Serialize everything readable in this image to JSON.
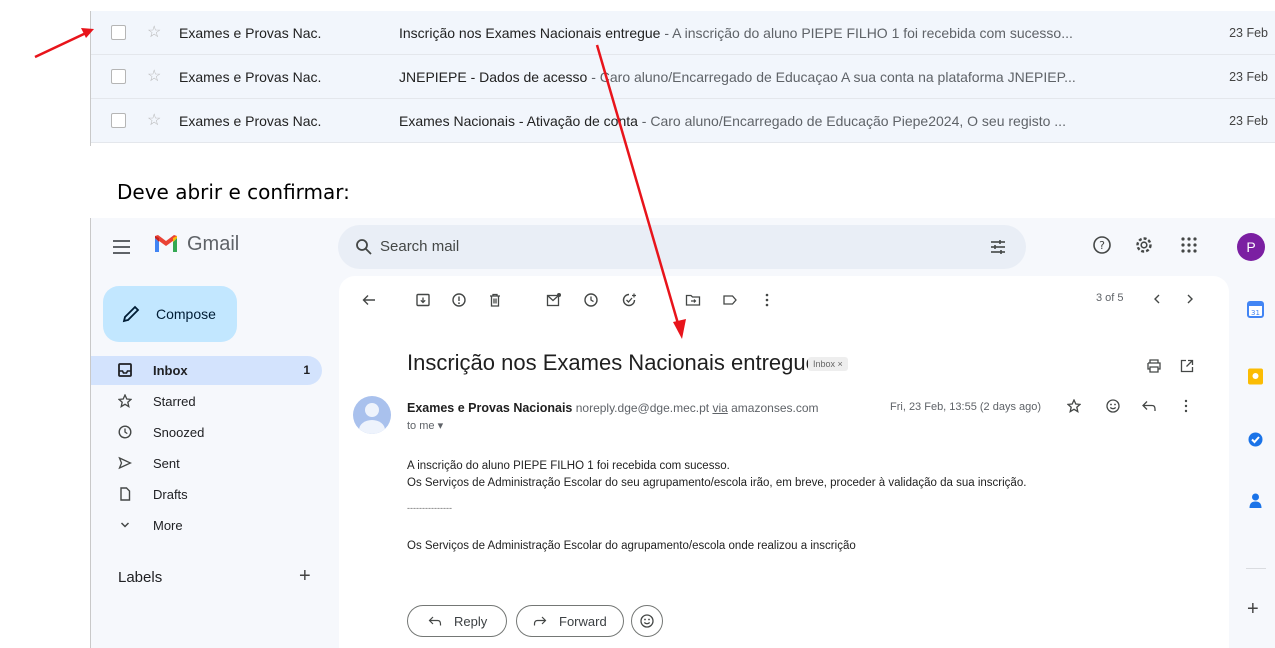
{
  "inbox_list": {
    "rows": [
      {
        "sender": "Exames e Provas Nac.",
        "subject": "Inscrição nos Exames Nacionais entregue",
        "snippet": " - A inscrição do aluno PIEPE FILHO 1 foi recebida com sucesso...",
        "date": "23 Feb"
      },
      {
        "sender": "Exames e Provas Nac.",
        "subject": "JNEPIEPE - Dados de acesso",
        "snippet": " - Caro aluno/Encarregado de Educaçao A sua conta na plataforma JNEPIEP...",
        "date": "23 Feb"
      },
      {
        "sender": "Exames e Provas Nac.",
        "subject": "Exames Nacionais - Ativação de conta",
        "snippet": " - Caro aluno/Encarregado de Educação Piepe2024, O seu registo ...",
        "date": "23 Feb"
      }
    ]
  },
  "instruction": "Deve abrir e confirmar:",
  "header": {
    "app_name": "Gmail",
    "search_placeholder": "Search mail",
    "avatar_letter": "P"
  },
  "sidebar": {
    "compose_label": "Compose",
    "items": [
      {
        "label": "Inbox",
        "count": "1",
        "icon": "inbox-icon",
        "active": true
      },
      {
        "label": "Starred",
        "count": "",
        "icon": "star-icon"
      },
      {
        "label": "Snoozed",
        "count": "",
        "icon": "clock-icon"
      },
      {
        "label": "Sent",
        "count": "",
        "icon": "send-icon"
      },
      {
        "label": "Drafts",
        "count": "",
        "icon": "draft-icon"
      },
      {
        "label": "More",
        "count": "",
        "icon": "chevron-down-icon"
      }
    ],
    "labels_title": "Labels"
  },
  "message": {
    "pager": "3 of 5",
    "subject": "Inscrição nos Exames Nacionais entregue",
    "label_badge": "Inbox ×",
    "sender_name": "Exames e Provas Nacionais",
    "sender_email": "noreply.dge@dge.mec.pt",
    "via_label": "via",
    "via_domain": "amazonses.com",
    "to": "to me ▾",
    "date": "Fri, 23 Feb, 13:55 (2 days ago)",
    "body_line1": "A inscrição do aluno PIEPE FILHO 1 foi recebida com sucesso.",
    "body_line2": "Os Serviços de Administração Escolar do seu agrupamento/escola irão, em breve, proceder à validação da sua inscrição.",
    "separator": "---------------",
    "signature": "Os Serviços de Administração Escolar do agrupamento/escola onde realizou a inscrição",
    "reply_label": "Reply",
    "forward_label": "Forward"
  },
  "colors": {
    "annotation_arrow": "#e8141b",
    "compose_bg": "#c2e7ff",
    "active_nav_bg": "#d3e3fd",
    "avatar_bg": "#7b1fa2"
  }
}
